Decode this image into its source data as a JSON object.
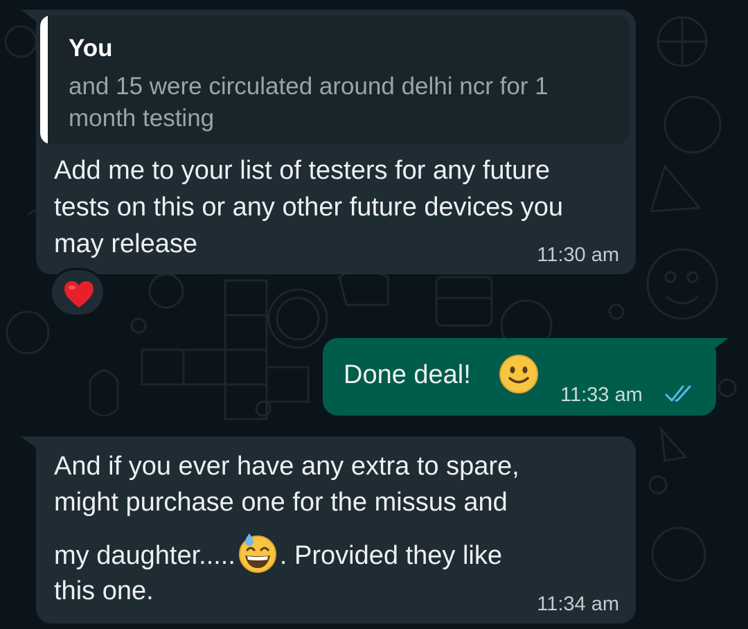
{
  "messages": [
    {
      "direction": "incoming",
      "quote": {
        "author": "You",
        "text": "and 15 were circulated around delhi ncr for 1 month testing"
      },
      "text": "Add me to your list of testers for any future tests on this or any other future devices you may release",
      "time": "11:30 am",
      "reaction": "heart-emoji"
    },
    {
      "direction": "outgoing",
      "text": "Done deal!",
      "emoji": "slightly-smiling-face-emoji",
      "time": "11:33 am",
      "status": "read-double-check"
    },
    {
      "direction": "incoming",
      "text_lines": [
        "And if you ever have any extra to spare,",
        "might purchase one for the missus and",
        "my daughter.....",
        ". Provided they like",
        "this one."
      ],
      "emoji": "grinning-face-with-sweat-emoji",
      "time": "11:34 am"
    }
  ],
  "colors": {
    "background": "#0b141a",
    "incoming_bubble": "#1f2c34",
    "outgoing_bubble": "#005c4b",
    "read_ticks": "#53bdeb"
  }
}
